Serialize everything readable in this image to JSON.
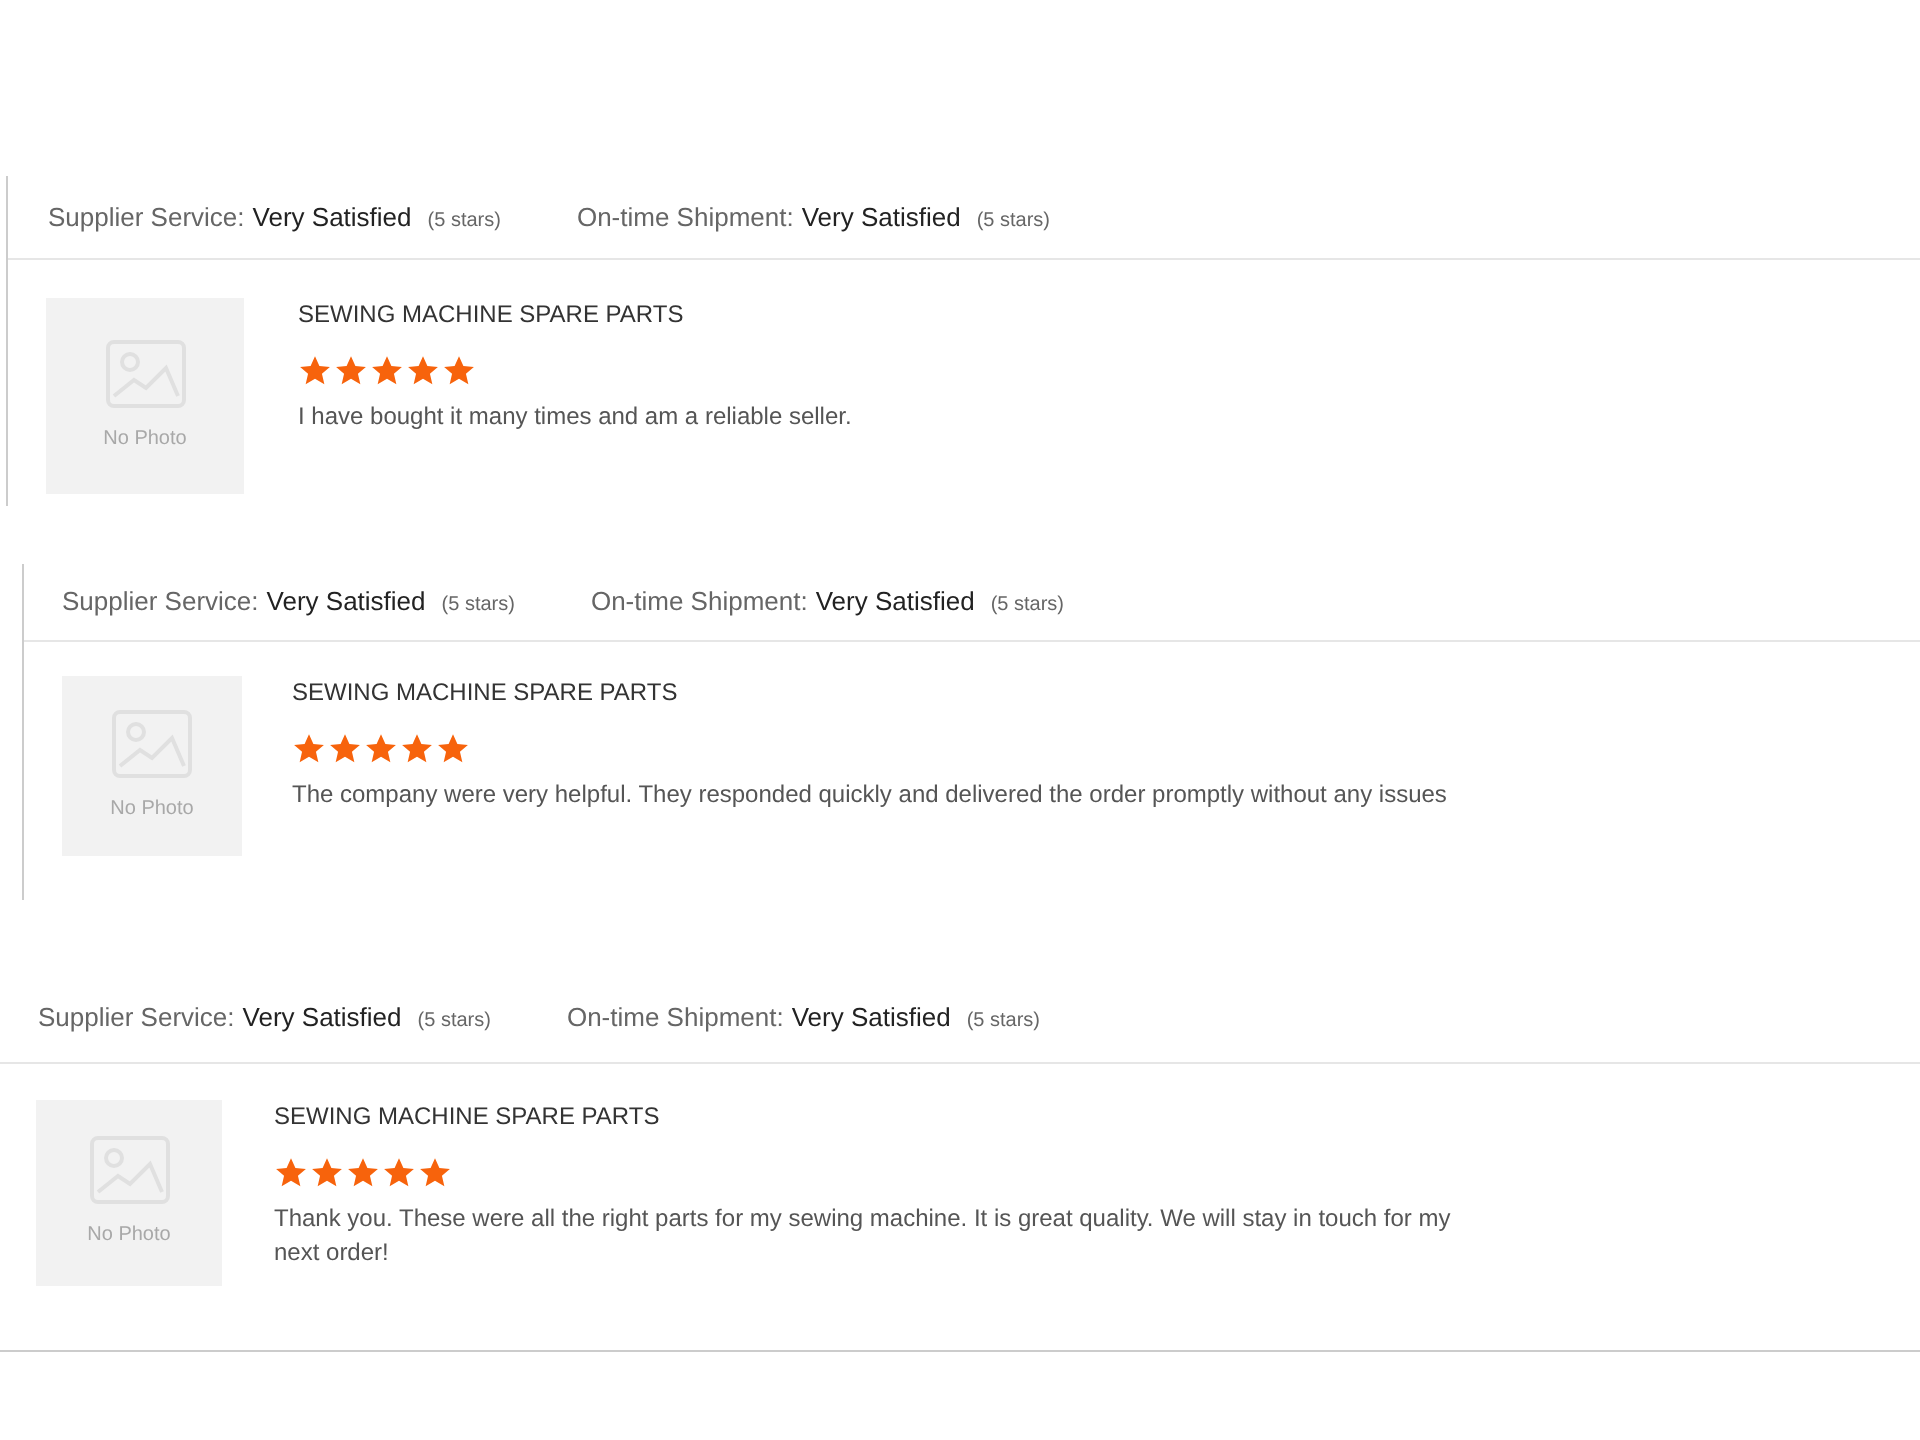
{
  "reviews": [
    {
      "supplier_service_label": "Supplier Service:",
      "supplier_service_value": "Very Satisfied",
      "supplier_service_stars": "(5 stars)",
      "shipment_label": "On-time Shipment:",
      "shipment_value": "Very Satisfied",
      "shipment_stars": "(5 stars)",
      "photo_text": "No Photo",
      "product": "SEWING MACHINE SPARE PARTS",
      "stars": 5,
      "comment": "I have bought it many times and am a reliable seller."
    },
    {
      "supplier_service_label": "Supplier Service:",
      "supplier_service_value": "Very Satisfied",
      "supplier_service_stars": "(5 stars)",
      "shipment_label": "On-time Shipment:",
      "shipment_value": "Very Satisfied",
      "shipment_stars": "(5 stars)",
      "photo_text": "No Photo",
      "product": "SEWING MACHINE SPARE PARTS",
      "stars": 5,
      "comment": "The company were very helpful. They responded quickly and delivered the order promptly without any issues"
    },
    {
      "supplier_service_label": "Supplier Service:",
      "supplier_service_value": "Very Satisfied",
      "supplier_service_stars": "(5 stars)",
      "shipment_label": "On-time Shipment:",
      "shipment_value": "Very Satisfied",
      "shipment_stars": "(5 stars)",
      "photo_text": "No Photo",
      "product": "SEWING MACHINE SPARE PARTS",
      "stars": 5,
      "comment": "Thank you. These were all the right parts for my sewing machine. It is great quality. We will stay in touch for my next order!"
    }
  ]
}
